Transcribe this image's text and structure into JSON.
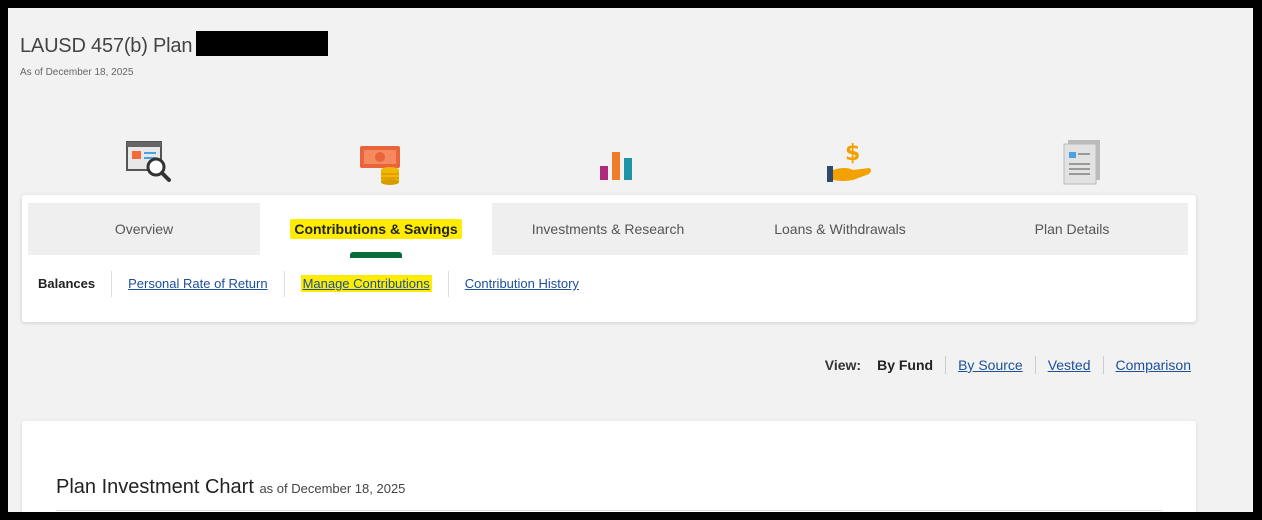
{
  "header": {
    "plan_name": "LAUSD 457(b) Plan",
    "as_of": "As of December 18, 2025"
  },
  "tabs": [
    {
      "label": "Overview",
      "icon": "report-search-icon"
    },
    {
      "label": "Contributions & Savings",
      "icon": "money-coins-icon",
      "active": true
    },
    {
      "label": "Investments & Research",
      "icon": "bar-chart-icon"
    },
    {
      "label": "Loans & Withdrawals",
      "icon": "hand-dollar-icon"
    },
    {
      "label": "Plan Details",
      "icon": "document-icon"
    }
  ],
  "subnav": [
    {
      "label": "Balances",
      "current": true
    },
    {
      "label": "Personal Rate of Return"
    },
    {
      "label": "Manage Contributions",
      "highlighted": true
    },
    {
      "label": "Contribution History"
    }
  ],
  "view": {
    "label": "View:",
    "options": [
      "By Fund",
      "By Source",
      "Vested",
      "Comparison"
    ],
    "selected": "By Fund"
  },
  "chart_section": {
    "title": "Plan Investment Chart",
    "subtitle": "as of December 18, 2025"
  },
  "colors": {
    "highlight": "#ffec00",
    "link": "#1c4f9c",
    "active_indicator": "#0a6b3a"
  }
}
